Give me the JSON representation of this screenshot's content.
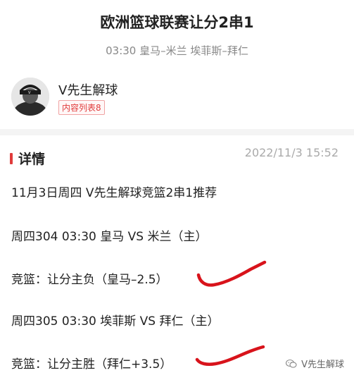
{
  "header": {
    "title": "欧洲篮球联赛让分2串1",
    "subtitle": "03:30 皇马–米兰 埃菲斯–拜仁"
  },
  "author": {
    "name": "V先生解球",
    "tag": "内容列表8"
  },
  "section": {
    "title": "详情",
    "date": "2022/11/3 15:52"
  },
  "content": {
    "lines": [
      "11月3日周四 V先生解球竞篮2串1推荐",
      "周四304 03:30 皇马 VS 米兰（主）",
      "竞篮：让分主负（皇马–2.5）",
      "周四305 03:30 埃菲斯 VS 拜仁（主）",
      "竞篮：让分主胜（拜仁+3.5）"
    ]
  },
  "watermark": {
    "text": "V先生解球",
    "icon": "wechat-icon"
  },
  "colors": {
    "accent": "#e03b3b",
    "squiggle": "#d8131b"
  }
}
